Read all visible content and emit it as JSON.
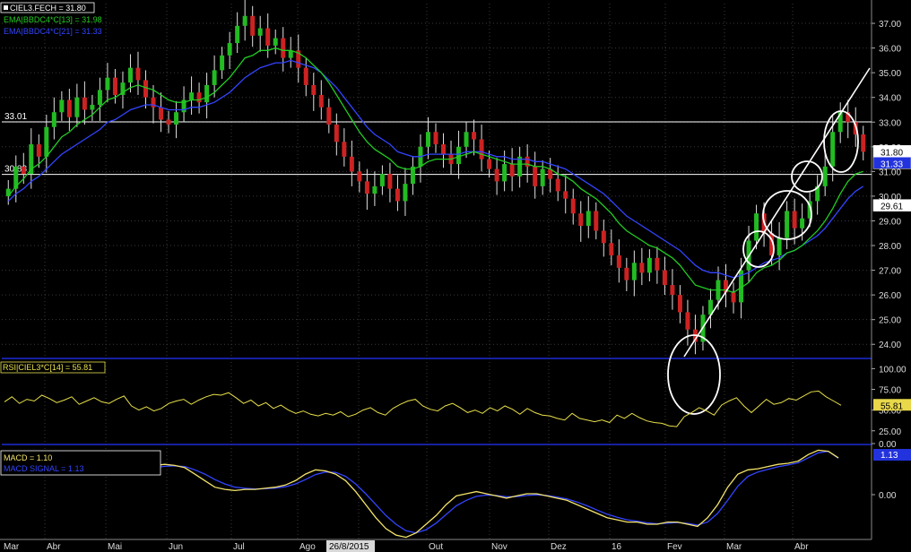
{
  "chart_data": {
    "type": "candlestick",
    "symbol_label": "CIEL3.FECH = 31.80",
    "x_ticks": [
      "Mar",
      "Abr",
      "Mai",
      "Jun",
      "Jul",
      "Ago",
      "26/8/2015",
      "Out",
      "Nov",
      "Dez",
      "16",
      "Fev",
      "Mar",
      "Abr"
    ],
    "price_panel": {
      "y_ticks": [
        "37.00",
        "36.00",
        "35.00",
        "34.00",
        "33.00",
        "32.00",
        "31.00",
        "30.00",
        "29.00",
        "28.00",
        "27.00",
        "26.00",
        "25.00",
        "24.00"
      ],
      "ylim": [
        23.5,
        37.8
      ],
      "horizontal_lines": [
        {
          "label": "33.01",
          "value": 33.01
        },
        {
          "label": "30.88",
          "value": 30.88
        }
      ],
      "right_badges": [
        {
          "text": "31.80",
          "value": 31.8,
          "color": "#ffffff"
        },
        {
          "text": "31.33",
          "value": 31.33,
          "color": "#2233ff"
        },
        {
          "text": "29.61",
          "value": 29.61,
          "color": "#ffffff"
        }
      ],
      "legend": [
        {
          "text": "CIEL3.FECH = 31.80",
          "color": "#ffffff"
        },
        {
          "text": "EMA|BBDC4*C[13] = 31.98",
          "color": "#22cc22"
        },
        {
          "text": "EMA|BBDC4*C[21] = 31.33",
          "color": "#3344ff"
        }
      ],
      "close_series": [
        30.3,
        31.2,
        30.9,
        32.1,
        31.6,
        32.8,
        33.4,
        33.9,
        33.2,
        34.0,
        33.5,
        33.7,
        34.3,
        34.8,
        34.1,
        34.6,
        35.2,
        34.7,
        34.0,
        33.6,
        33.1,
        32.9,
        33.4,
        33.9,
        34.2,
        33.8,
        34.5,
        35.1,
        35.7,
        36.2,
        36.9,
        37.3,
        36.5,
        36.8,
        36.1,
        36.4,
        35.6,
        35.9,
        35.2,
        34.5,
        34.1,
        33.6,
        32.9,
        32.2,
        31.6,
        31.0,
        30.6,
        30.1,
        30.4,
        30.9,
        30.3,
        29.8,
        30.5,
        31.2,
        32.0,
        32.6,
        32.1,
        31.7,
        31.3,
        32.0,
        32.6,
        32.3,
        31.5,
        31.1,
        30.6,
        31.3,
        30.8,
        31.6,
        31.2,
        30.4,
        31.1,
        30.7,
        30.2,
        29.9,
        29.3,
        28.8,
        29.4,
        28.6,
        28.1,
        27.6,
        27.1,
        26.6,
        27.3,
        26.9,
        27.5,
        27.0,
        26.4,
        26.0,
        25.3,
        24.6,
        24.1,
        25.2,
        25.8,
        26.6,
        26.1,
        25.7,
        27.0,
        28.2,
        29.3,
        28.5,
        27.6,
        28.3,
        29.4,
        28.7,
        29.1,
        29.8,
        30.4,
        31.2,
        32.6,
        33.4,
        33.0,
        32.5,
        31.8
      ],
      "ema13": [
        30.0,
        30.4,
        30.7,
        31.1,
        31.3,
        31.6,
        32.0,
        32.4,
        32.6,
        32.9,
        33.1,
        33.3,
        33.6,
        33.9,
        34.0,
        34.2,
        34.4,
        34.5,
        34.4,
        34.3,
        34.1,
        33.9,
        33.8,
        33.8,
        33.9,
        33.9,
        34.0,
        34.2,
        34.5,
        34.8,
        35.2,
        35.6,
        35.7,
        35.9,
        35.9,
        36.0,
        35.9,
        35.9,
        35.8,
        35.6,
        35.3,
        35.0,
        34.6,
        34.1,
        33.6,
        33.1,
        32.6,
        32.2,
        31.9,
        31.7,
        31.5,
        31.2,
        31.1,
        31.1,
        31.2,
        31.4,
        31.5,
        31.5,
        31.5,
        31.6,
        31.7,
        31.8,
        31.7,
        31.6,
        31.5,
        31.4,
        31.3,
        31.3,
        31.3,
        31.2,
        31.2,
        31.1,
        30.9,
        30.8,
        30.6,
        30.3,
        30.1,
        29.9,
        29.6,
        29.3,
        28.9,
        28.6,
        28.4,
        28.2,
        28.0,
        27.9,
        27.7,
        27.5,
        27.2,
        26.8,
        26.4,
        26.3,
        26.2,
        26.2,
        26.2,
        26.1,
        26.3,
        26.5,
        26.9,
        27.1,
        27.2,
        27.4,
        27.7,
        27.8,
        28.0,
        28.3,
        28.6,
        29.0,
        29.5,
        30.1,
        30.6,
        30.9,
        31.0
      ],
      "ema21": [
        29.8,
        30.1,
        30.3,
        30.6,
        30.8,
        31.1,
        31.4,
        31.7,
        31.9,
        32.1,
        32.3,
        32.5,
        32.7,
        33.0,
        33.1,
        33.3,
        33.5,
        33.6,
        33.7,
        33.7,
        33.6,
        33.5,
        33.5,
        33.5,
        33.6,
        33.6,
        33.7,
        33.8,
        34.0,
        34.2,
        34.5,
        34.8,
        35.0,
        35.2,
        35.3,
        35.4,
        35.4,
        35.5,
        35.4,
        35.3,
        35.2,
        35.0,
        34.7,
        34.4,
        34.0,
        33.6,
        33.2,
        32.8,
        32.5,
        32.3,
        32.1,
        31.8,
        31.7,
        31.6,
        31.6,
        31.7,
        31.7,
        31.7,
        31.7,
        31.7,
        31.8,
        31.8,
        31.8,
        31.7,
        31.6,
        31.6,
        31.5,
        31.5,
        31.5,
        31.4,
        31.4,
        31.3,
        31.2,
        31.1,
        30.9,
        30.7,
        30.5,
        30.3,
        30.1,
        29.8,
        29.5,
        29.2,
        29.0,
        28.8,
        28.6,
        28.4,
        28.2,
        28.0,
        27.8,
        27.5,
        27.2,
        27.0,
        26.9,
        26.9,
        26.8,
        26.7,
        26.8,
        26.9,
        27.1,
        27.3,
        27.4,
        27.5,
        27.7,
        27.8,
        28.0,
        28.2,
        28.4,
        28.7,
        29.1,
        29.5,
        29.9,
        30.2,
        30.4
      ]
    },
    "rsi_panel": {
      "label": "RSI|CIEL3*C[14] = 55.81",
      "y_ticks": [
        "100.00",
        "75.00",
        "50.00",
        "25.00"
      ],
      "ylim": [
        15,
        108
      ],
      "badge": "55.81",
      "badge_value": 55.81,
      "values": [
        60,
        66,
        58,
        63,
        61,
        68,
        64,
        59,
        62,
        66,
        57,
        61,
        65,
        60,
        58,
        63,
        67,
        55,
        50,
        54,
        49,
        52,
        58,
        61,
        63,
        57,
        62,
        66,
        69,
        68,
        71,
        65,
        58,
        62,
        55,
        59,
        52,
        56,
        50,
        46,
        49,
        45,
        43,
        46,
        44,
        48,
        42,
        45,
        50,
        53,
        47,
        44,
        52,
        57,
        61,
        63,
        55,
        51,
        49,
        55,
        58,
        53,
        47,
        50,
        46,
        53,
        49,
        55,
        51,
        45,
        52,
        47,
        44,
        43,
        40,
        38,
        46,
        40,
        38,
        36,
        38,
        35,
        44,
        40,
        46,
        41,
        37,
        35,
        34,
        31,
        30,
        42,
        47,
        53,
        49,
        44,
        56,
        61,
        65,
        55,
        47,
        55,
        63,
        57,
        59,
        64,
        62,
        67,
        72,
        73,
        66,
        61,
        55.81
      ]
    },
    "macd_panel": {
      "label": "MACD = 1.10",
      "signal_label": "MACD SIGNAL = 1.13",
      "y_ticks": [
        "0.00",
        "0.00"
      ],
      "ylim": [
        -2.6,
        1.6
      ],
      "badge": "1.13",
      "badge_value": 1.13,
      "macd": [
        0.6,
        0.75,
        0.8,
        0.85,
        0.8,
        0.7,
        0.4,
        0.1,
        -0.2,
        -0.3,
        -0.35,
        -0.3,
        -0.3,
        -0.25,
        -0.2,
        -0.1,
        0.1,
        0.4,
        0.6,
        0.55,
        0.4,
        0.1,
        -0.4,
        -1.0,
        -1.6,
        -2.1,
        -2.4,
        -2.5,
        -2.3,
        -1.9,
        -1.5,
        -1.0,
        -0.6,
        -0.5,
        -0.4,
        -0.5,
        -0.6,
        -0.7,
        -0.6,
        -0.5,
        -0.5,
        -0.6,
        -0.7,
        -0.8,
        -1.0,
        -1.2,
        -1.4,
        -1.6,
        -1.7,
        -1.8,
        -1.8,
        -1.9,
        -1.9,
        -1.8,
        -1.8,
        -1.9,
        -2.0,
        -1.6,
        -1.0,
        -0.2,
        0.4,
        0.6,
        0.65,
        0.75,
        0.85,
        0.9,
        1.0,
        1.3,
        1.5,
        1.45,
        1.15
      ],
      "signal": [
        0.5,
        0.62,
        0.7,
        0.76,
        0.78,
        0.75,
        0.6,
        0.4,
        0.15,
        -0.05,
        -0.2,
        -0.25,
        -0.28,
        -0.27,
        -0.24,
        -0.18,
        -0.05,
        0.15,
        0.38,
        0.5,
        0.48,
        0.3,
        -0.05,
        -0.5,
        -1.0,
        -1.5,
        -1.9,
        -2.2,
        -2.3,
        -2.15,
        -1.85,
        -1.45,
        -1.05,
        -0.8,
        -0.62,
        -0.56,
        -0.58,
        -0.64,
        -0.63,
        -0.58,
        -0.55,
        -0.58,
        -0.65,
        -0.74,
        -0.88,
        -1.05,
        -1.25,
        -1.44,
        -1.58,
        -1.7,
        -1.76,
        -1.84,
        -1.88,
        -1.85,
        -1.82,
        -1.86,
        -1.94,
        -1.8,
        -1.4,
        -0.8,
        -0.15,
        0.3,
        0.5,
        0.62,
        0.74,
        0.82,
        0.92,
        1.15,
        1.38,
        1.45,
        1.13
      ]
    },
    "colors": {
      "background": "#000000",
      "grid": "#3a3a3a",
      "up_candle": "#22bb22",
      "down_candle": "#cc2222",
      "wick": "#e0e0e0",
      "ema_short": "#22cc22",
      "ema_long": "#3344ff",
      "rsi_line": "#e8e04a",
      "macd_line": "#f4e46a",
      "signal_line": "#3344ff",
      "panel_divider": "#2233ff",
      "annotation": "#ffffff"
    }
  }
}
